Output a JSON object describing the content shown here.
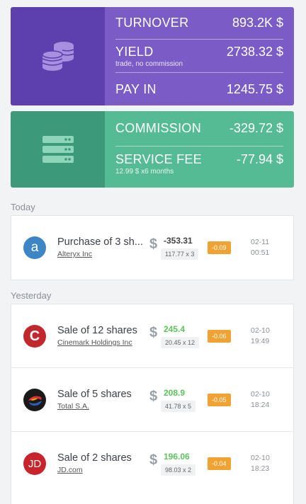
{
  "summary": {
    "turnover": {
      "label": "TURNOVER",
      "value": "893.2K $"
    },
    "yield": {
      "label": "YIELD",
      "value": "2738.32 $",
      "sub": "trade, no commission"
    },
    "pay_in": {
      "label": "PAY IN",
      "value": "1245.75 $"
    }
  },
  "costs": {
    "commission": {
      "label": "COMMISSION",
      "value": "-329.72 $"
    },
    "service_fee": {
      "label": "SERVICE FEE",
      "value": "-77.94 $",
      "sub": "12.99 $ x6 months"
    }
  },
  "sections": {
    "today": "Today",
    "yesterday": "Yesterday"
  },
  "transactions": [
    {
      "title": "Purchase of 3 sh...",
      "company": "Alteryx Inc",
      "currency": "$",
      "amount": "-353.31",
      "qty": "117.77 x 3",
      "fee": "-0.09",
      "date": "02-11",
      "time": "00:51",
      "logo": "a"
    },
    {
      "title": "Sale of 12 shares",
      "company": "Cinemark Holdings Inc",
      "currency": "$",
      "amount": "245.4",
      "qty": "20.45 x 12",
      "fee": "-0.06",
      "date": "02-10",
      "time": "19:49",
      "logo": "C"
    },
    {
      "title": "Sale of 5 shares",
      "company": "Total S.A.",
      "currency": "$",
      "amount": "208.9",
      "qty": "41.78 x 5",
      "fee": "-0.05",
      "date": "02-10",
      "time": "18:24",
      "logo": ""
    },
    {
      "title": "Sale of 2 shares",
      "company": "JD.com",
      "currency": "$",
      "amount": "196.06",
      "qty": "98.03 x 2",
      "fee": "-0.04",
      "date": "02-10",
      "time": "18:23",
      "logo": "JD"
    }
  ],
  "colors": {
    "purple": "#7b5bc5",
    "green": "#55bb95",
    "fee_badge": "#f0a332",
    "positive": "#5cc45c"
  },
  "icons": {
    "summary": "coins-stack-icon",
    "costs": "server-icon"
  }
}
